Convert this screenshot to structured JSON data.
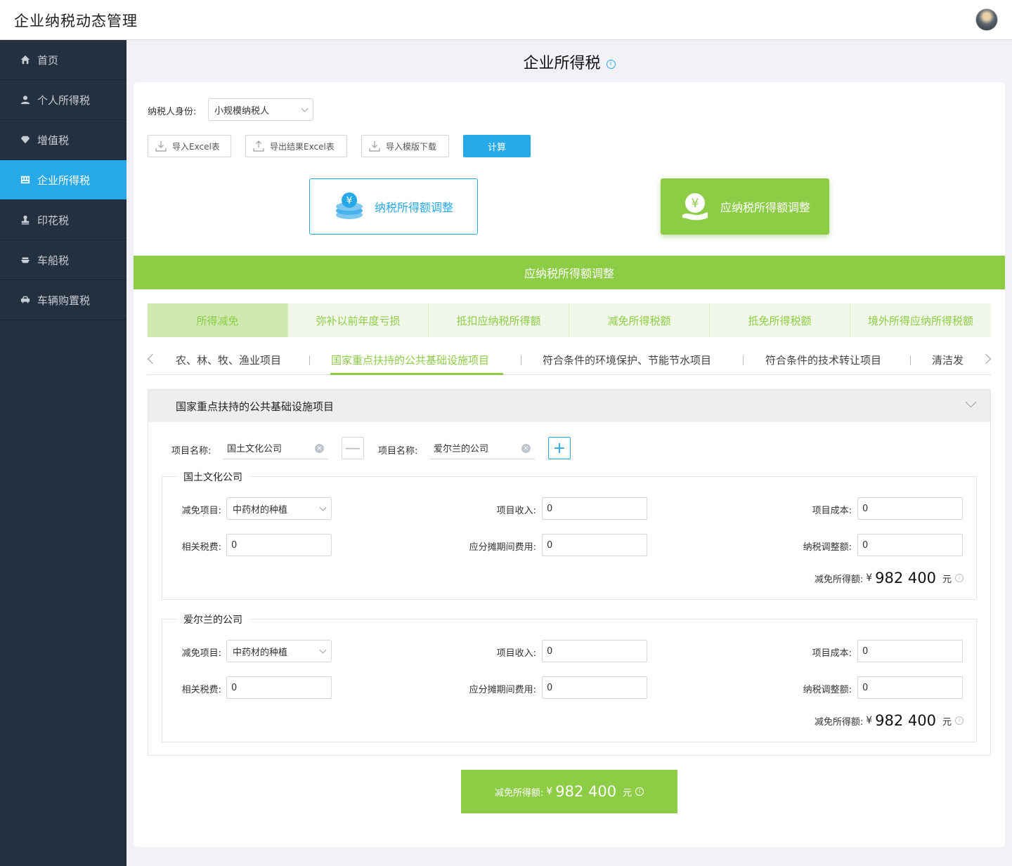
{
  "app": {
    "title": "企业纳税动态管理"
  },
  "sidebar": {
    "items": [
      {
        "label": "首页",
        "icon": "home-icon"
      },
      {
        "label": "个人所得税",
        "icon": "user-icon"
      },
      {
        "label": "增值税",
        "icon": "diamond-icon"
      },
      {
        "label": "企业所得税",
        "icon": "building-icon",
        "active": true
      },
      {
        "label": "印花税",
        "icon": "stamp-icon"
      },
      {
        "label": "车船税",
        "icon": "boat-icon"
      },
      {
        "label": "车辆购置税",
        "icon": "car-icon"
      }
    ]
  },
  "page": {
    "title": "企业所得税",
    "info_glyph": "i"
  },
  "form": {
    "identity_label": "纳税人身份:",
    "identity_value": "小规模纳税人"
  },
  "toolbar": {
    "import_excel": "导入Excel表",
    "export_excel": "导出结果Excel表",
    "download_template": "导入模版下载",
    "calculate": "计算"
  },
  "cards": {
    "taxable_income": "纳税所得额调整",
    "payable_income": "应纳税所得额调整"
  },
  "section_bar": "应纳税所得额调整",
  "category_tabs": [
    "所得减免",
    "弥补以前年度亏损",
    "抵扣应纳税所得额",
    "减免所得税额",
    "抵免所得税额",
    "境外所得应纳所得税额"
  ],
  "sub_tabs": [
    "农、林、牧、渔业项目",
    "国家重点扶持的公共基础设施项目",
    "符合条件的环境保护、节能节水项目",
    "符合条件的技术转让项目",
    "清洁发"
  ],
  "panel": {
    "title": "国家重点扶持的公共基础设施项目",
    "project_name_label": "项目名称:",
    "project_1": "国土文化公司",
    "project_2": "爱尔兰的公司",
    "minus": "—",
    "plus": "+",
    "clear": "×"
  },
  "labels": {
    "exempt_item": "减免项目:",
    "project_income": "项目收入:",
    "project_cost": "项目成本:",
    "related_taxes": "相关税费:",
    "apportioned_expense": "应分摊期间费用:",
    "tax_adjustment": "纳税调整额:",
    "exempt_income": "减免所得额:"
  },
  "groups": [
    {
      "name": "国土文化公司",
      "exempt_item": "中药材的种植",
      "project_income": "0",
      "project_cost": "0",
      "related_taxes": "0",
      "apportioned_expense": "0",
      "tax_adjustment": "0",
      "currency": "¥",
      "amount": "982 400",
      "unit": "元"
    },
    {
      "name": "爱尔兰的公司",
      "exempt_item": "中药材的种植",
      "project_income": "0",
      "project_cost": "0",
      "related_taxes": "0",
      "apportioned_expense": "0",
      "tax_adjustment": "0",
      "currency": "¥",
      "amount": "982 400",
      "unit": "元"
    }
  ],
  "total": {
    "label": "减免所得额:",
    "currency": "¥",
    "amount": "982 400",
    "unit": "元"
  },
  "colors": {
    "primary": "#27a8e7",
    "green": "#8dcc45",
    "sidebar": "#24303f"
  }
}
